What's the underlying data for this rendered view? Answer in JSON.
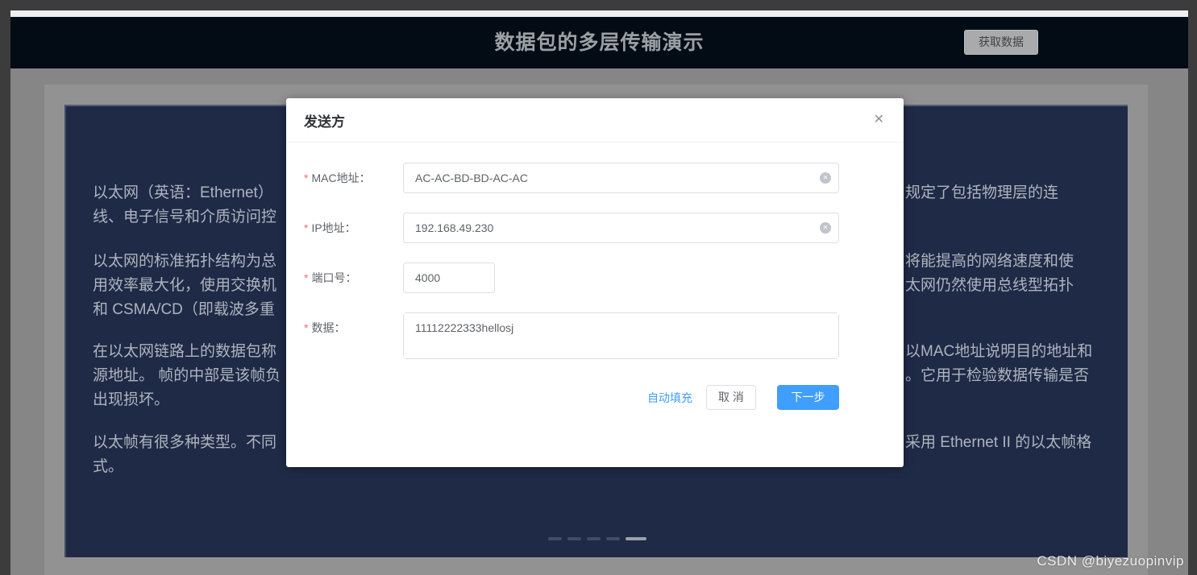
{
  "header": {
    "title": "数据包的多层传输演示",
    "fetch_button": "获取数据"
  },
  "background": {
    "lines": [
      {
        "left": "以太网（英语：Ethernet）",
        "right": "规定了包括物理层的连"
      },
      {
        "left": "线、电子信号和介质访问控",
        "right": ""
      },
      {
        "left": "以太网的标准拓扑结构为总",
        "right": "将能提高的网络速度和使"
      },
      {
        "left": "用效率最大化，使用交换机",
        "right": "太网仍然使用总线型拓扑"
      },
      {
        "left": "和 CSMA/CD（即载波多重",
        "right": ""
      },
      {
        "left": "在以太网链路上的数据包称",
        "right": "以MAC地址说明目的地址和"
      },
      {
        "left": "源地址。 帧的中部是该帧负",
        "right": "。它用于检验数据传输是否"
      },
      {
        "left": "出现损坏。",
        "right": ""
      },
      {
        "left": "以太帧有很多种类型。不同",
        "right": "采用 Ethernet II 的以太帧格"
      },
      {
        "left": "式。",
        "right": ""
      }
    ],
    "pagination": {
      "count": 5,
      "active_index": 4
    }
  },
  "watermark": "CSDN @biyezuopinvip",
  "dialog": {
    "title": "发送方",
    "required_mark": "*",
    "fields": [
      {
        "label": "MAC地址：",
        "value": "AC-AC-BD-BD-AC-AC"
      },
      {
        "label": "IP地址：",
        "value": "192.168.49.230"
      },
      {
        "label": "端口号：",
        "value": "4000"
      },
      {
        "label": "数据：",
        "value": "11112222333hellosj"
      }
    ],
    "footer": {
      "autofill": "自动填充",
      "cancel": "取 消",
      "next": "下一步"
    }
  },
  "icons": {
    "close": "✕",
    "clear": "✕"
  },
  "colors": {
    "primary": "#409eff",
    "required": "#f56c6c",
    "header_bar": "#030c14",
    "panel": "#1f2a47",
    "page_mask_gray": "#8e8e8e",
    "dash_active": "#9aa1ab",
    "dash_inactive": "#424c61"
  }
}
